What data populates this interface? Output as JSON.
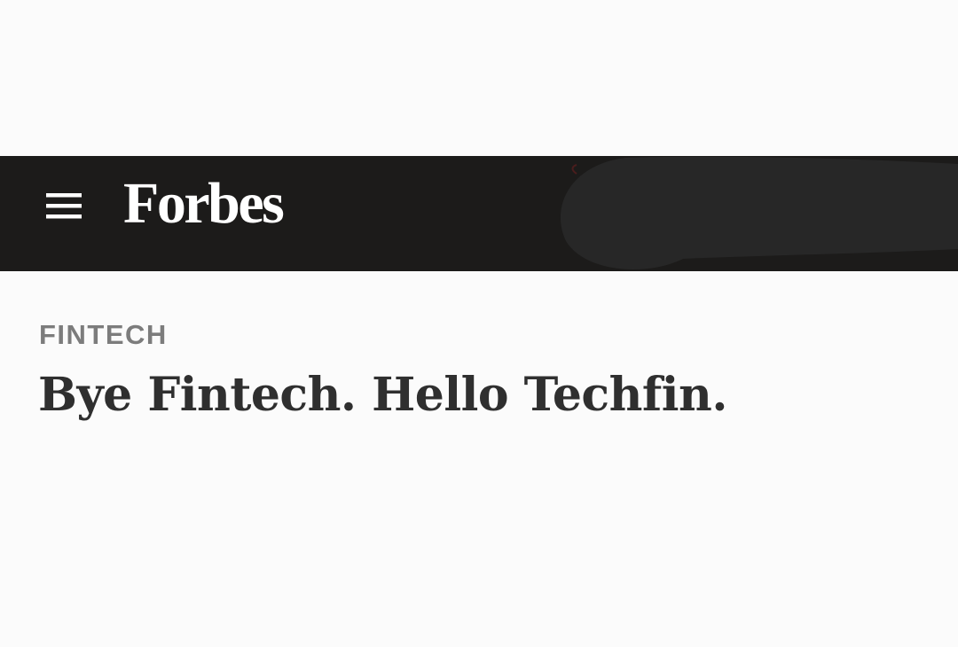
{
  "header": {
    "logo_text": "Forbes",
    "menu_icon": "hamburger-menu-icon",
    "background_color": "#1c1b1a"
  },
  "article": {
    "section": "FINTECH",
    "headline": "Bye Fintech. Hello Techfin."
  }
}
